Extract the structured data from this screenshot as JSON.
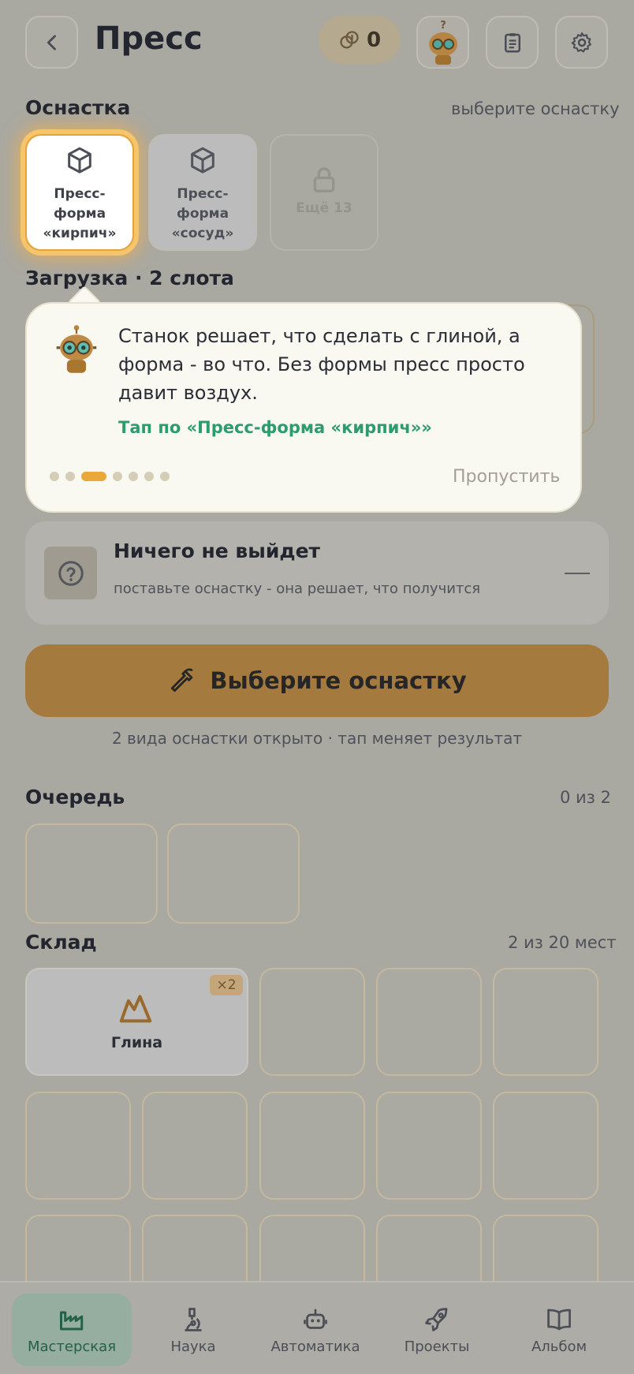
{
  "header": {
    "title": "Пресс",
    "coins": "0"
  },
  "tooling": {
    "title": "Оснастка",
    "note": "выберите оснастку",
    "items": [
      {
        "label": "Пресс-форма «кирпич»"
      },
      {
        "label": "Пресс-форма «сосуд»"
      },
      {
        "label": "Ещё 13"
      }
    ]
  },
  "loading": {
    "title": "Загрузка · 2 слота"
  },
  "tooltip": {
    "text": "Станок решает, что сделать с глиной, а форма - во что. Без формы пресс просто давит воздух.",
    "action": "Тап по «Пресс-форма «кирпич»»",
    "skip": "Пропустить",
    "step": 3,
    "steps_total": 7
  },
  "result": {
    "title": "Ничего не выйдет",
    "subtitle": "поставьте оснастку - она решает, что получится"
  },
  "main_button": {
    "label": "Выберите оснастку"
  },
  "hint": "2 вида оснастки открыто · тап меняет результат",
  "queue": {
    "title": "Очередь",
    "count": "0 из 2"
  },
  "warehouse": {
    "title": "Склад",
    "count": "2 из 20 мест",
    "items": [
      {
        "name": "Глина",
        "qty": "×2"
      }
    ]
  },
  "nav": {
    "items": [
      {
        "label": "Мастерская",
        "icon": "factory-icon",
        "active": true
      },
      {
        "label": "Наука",
        "icon": "microscope-icon"
      },
      {
        "label": "Автоматика",
        "icon": "robot-icon"
      },
      {
        "label": "Проекты",
        "icon": "rocket-icon"
      },
      {
        "label": "Альбом",
        "icon": "book-icon"
      }
    ]
  },
  "colors": {
    "accent": "#e8a93a",
    "action_green": "#2e9b6d",
    "main_button": "#a57a3f"
  }
}
